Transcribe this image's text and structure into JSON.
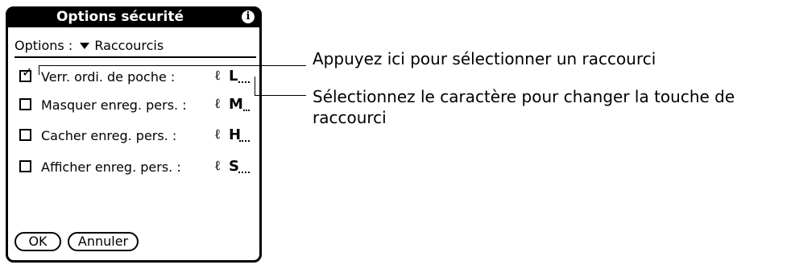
{
  "dialog": {
    "title": "Options sécurité",
    "info_icon": "i",
    "options_label": "Options :",
    "options_value": "Raccourcis",
    "shortcuts": [
      {
        "label": "Verr. ordi. de poche :",
        "checked": true,
        "key": "L"
      },
      {
        "label": "Masquer enreg. pers. :",
        "checked": false,
        "key": "M"
      },
      {
        "label": "Cacher enreg. pers. :",
        "checked": false,
        "key": "H"
      },
      {
        "label": "Afficher enreg. pers. :",
        "checked": false,
        "key": "S"
      }
    ],
    "stroke_glyph": "ℓ",
    "checkmark": "✓",
    "ok_label": "OK",
    "cancel_label": "Annuler"
  },
  "callouts": {
    "first": "Appuyez ici pour sélectionner un raccourci",
    "second_line1": "Sélectionnez le caractère pour changer la touche de",
    "second_line2": "raccourci"
  }
}
